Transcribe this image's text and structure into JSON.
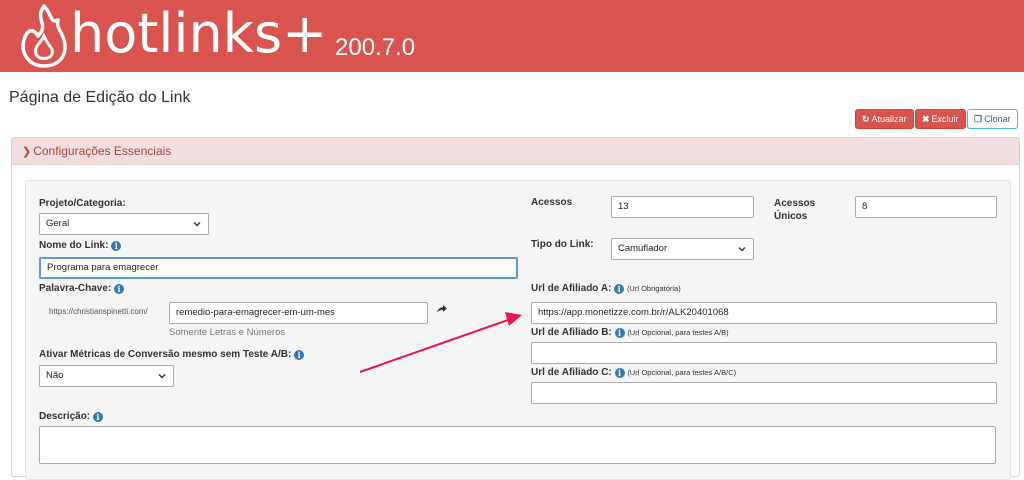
{
  "header": {
    "logo_text": "hotlinks+",
    "version": "200.7.0",
    "brand_color": "#d9534f"
  },
  "page": {
    "title": "Página de Edição do Link"
  },
  "actions": {
    "update_label": "Atualizar",
    "delete_label": "Excluir",
    "clone_label": "Clonar",
    "update_icon": "refresh-icon",
    "delete_icon": "x-icon",
    "clone_icon": "copy-icon"
  },
  "panel": {
    "heading": "Configurações Essenciais",
    "heading_icon": "chevron-down-icon"
  },
  "form": {
    "project": {
      "label": "Projeto/Categoria:",
      "value": "Geral"
    },
    "link_name": {
      "label": "Nome do Link:",
      "value": "Programa para emagrecer"
    },
    "keyword": {
      "label": "Palavra-Chave:",
      "prefix": "https://christianspinetti.com/",
      "value": "remedio-para-emagrecer-em-um-mes",
      "help": "Somente Letras e Números",
      "open_icon": "share-arrow-icon"
    },
    "metrics": {
      "label": "Ativar Métricas de Conversão mesmo sem Teste A/B:",
      "value": "Não"
    },
    "description": {
      "label": "Descrição:",
      "value": ""
    },
    "accesses": {
      "label": "Acessos",
      "value": "13"
    },
    "unique_accesses": {
      "label_line1": "Acessos",
      "label_line2": "Únicos",
      "value": "8"
    },
    "link_type": {
      "label": "Tipo do Link:",
      "value": "Camuflador"
    },
    "affiliate_a": {
      "label": "Url de Afiliado A:",
      "note": "(Url Obrigatória)",
      "value": "https://app.monetizze.com.br/r/ALK20401068"
    },
    "affiliate_b": {
      "label": "Url de Afiliado B:",
      "note": "(Url Opcional, para testes A/B)",
      "value": ""
    },
    "affiliate_c": {
      "label": "Url de Afiliado C:",
      "note": "(Url Opcional, para testes A/B/C)",
      "value": ""
    }
  },
  "annotation": {
    "color": "#e8174f"
  }
}
